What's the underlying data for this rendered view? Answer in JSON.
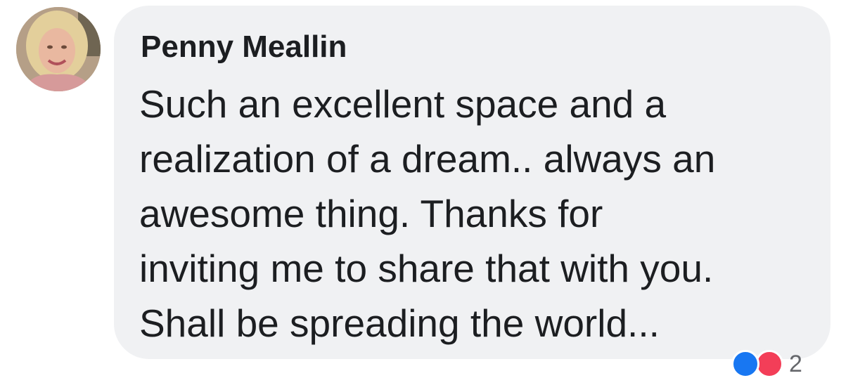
{
  "comment": {
    "author": "Penny Meallin",
    "text_lines": [
      "Such an excellent space and a",
      "realization of a dream.. always an",
      "awesome thing. Thanks for",
      "inviting me to share that with you.",
      "Shall be spreading the world..."
    ]
  },
  "reactions": {
    "icons": [
      "like-icon",
      "love-icon"
    ],
    "count": "2"
  },
  "colors": {
    "bubble_background": "#f0f1f3",
    "text": "#1c1e21",
    "like": "#1877f2",
    "love": "#f33e58"
  }
}
